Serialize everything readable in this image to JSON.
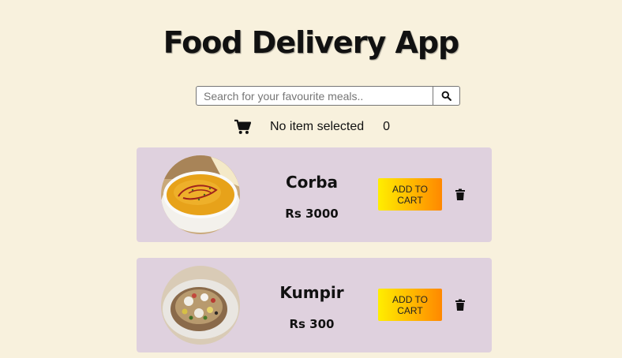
{
  "app": {
    "title": "Food Delivery App"
  },
  "search": {
    "placeholder": "Search for your favourite meals..",
    "value": "",
    "button_icon": "search-icon"
  },
  "cart": {
    "icon": "shopping-cart-icon",
    "status": "No item selected",
    "count": "0"
  },
  "items": [
    {
      "name": "Corba",
      "price": "Rs 3000",
      "add_label": "ADD TO CART",
      "delete_icon": "trash-icon",
      "image": "lentil-soup-bowl"
    },
    {
      "name": "Kumpir",
      "price": "Rs 300",
      "add_label": "ADD TO CART",
      "delete_icon": "trash-icon",
      "image": "stuffed-baked-potato"
    }
  ],
  "colors": {
    "background": "#f8f1dd",
    "card": "#dfd1de",
    "button_gradient_start": "#ffee00",
    "button_gradient_end": "#ff8800"
  }
}
